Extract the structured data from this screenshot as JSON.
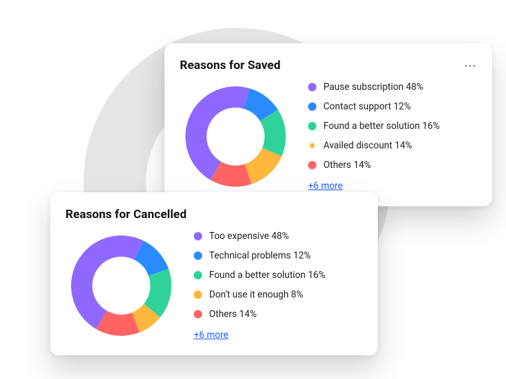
{
  "colors": {
    "purple": "#8f69ff",
    "blue": "#2a8bff",
    "teal": "#2fd39a",
    "yellow": "#ffb63d",
    "red": "#ff6464"
  },
  "cards": [
    {
      "key": "saved",
      "title": "Reasons for Saved",
      "show_more_icon": true,
      "more_link": "+6 more",
      "items": [
        {
          "label": "Pause subscription 48%",
          "value": 48,
          "color": "purple",
          "ring": false
        },
        {
          "label": "Contact support 12%",
          "value": 12,
          "color": "blue",
          "ring": false
        },
        {
          "label": "Found a better solution 16%",
          "value": 16,
          "color": "teal",
          "ring": false
        },
        {
          "label": "Availed discount 14%",
          "value": 14,
          "color": "yellow",
          "ring": true
        },
        {
          "label": "Others 14%",
          "value": 14,
          "color": "red",
          "ring": false
        }
      ]
    },
    {
      "key": "cancelled",
      "title": "Reasons for Cancelled",
      "show_more_icon": false,
      "more_link": "+6 more",
      "items": [
        {
          "label": "Too expensive 48%",
          "value": 48,
          "color": "purple",
          "ring": false
        },
        {
          "label": "Technical problems 12%",
          "value": 12,
          "color": "blue",
          "ring": false
        },
        {
          "label": "Found a better solution 16%",
          "value": 16,
          "color": "teal",
          "ring": false
        },
        {
          "label": "Don't use it enough 8%",
          "value": 8,
          "color": "yellow",
          "ring": false
        },
        {
          "label": "Others 14%",
          "value": 14,
          "color": "red",
          "ring": false
        }
      ]
    }
  ],
  "chart_data": [
    {
      "type": "pie",
      "title": "Reasons for Saved",
      "categories": [
        "Pause subscription",
        "Contact support",
        "Found a better solution",
        "Availed discount",
        "Others"
      ],
      "values": [
        48,
        12,
        16,
        14,
        14
      ],
      "colors": [
        "#8f69ff",
        "#2a8bff",
        "#2fd39a",
        "#ffb63d",
        "#ff6464"
      ],
      "more_hidden": 6
    },
    {
      "type": "pie",
      "title": "Reasons for Cancelled",
      "categories": [
        "Too expensive",
        "Technical problems",
        "Found a better solution",
        "Don't use it enough",
        "Others"
      ],
      "values": [
        48,
        12,
        16,
        8,
        14
      ],
      "colors": [
        "#8f69ff",
        "#2a8bff",
        "#2fd39a",
        "#ffb63d",
        "#ff6464"
      ],
      "more_hidden": 6
    }
  ]
}
